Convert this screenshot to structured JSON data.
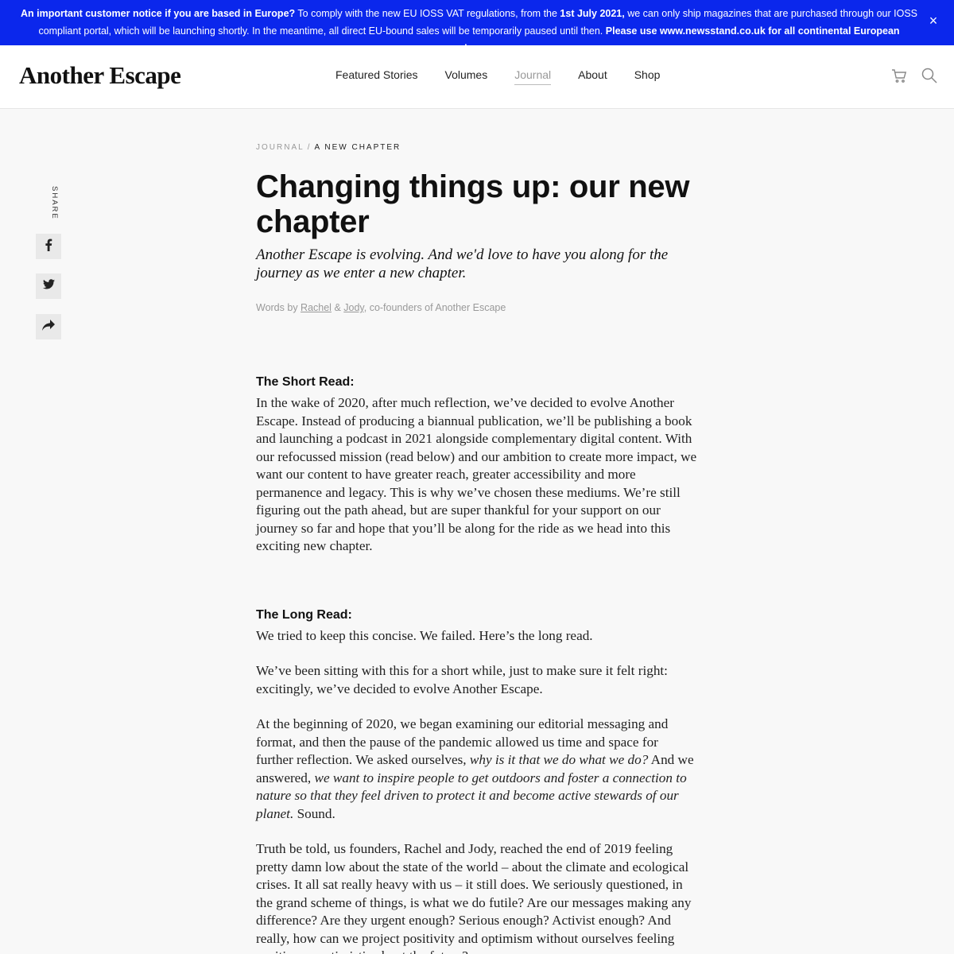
{
  "notice": {
    "lead": "An important customer notice if you are based in Europe?",
    "text1": " To comply with the new EU IOSS VAT regulations, from the ",
    "date": "1st July 2021,",
    "text2": " we can only ship magazines that are purchased through our IOSS compliant portal, which will be launching shortly. In the meantime, all direct EU-bound sales will be temporarily paused until then. ",
    "cta": "Please use www.newsstand.co.uk for all continental European purchases.",
    "close": "×"
  },
  "header": {
    "logo": "Another Escape",
    "nav": [
      "Featured Stories",
      "Volumes",
      "Journal",
      "About",
      "Shop"
    ],
    "active_nav": "Journal"
  },
  "share": {
    "label": "SHARE"
  },
  "article": {
    "breadcrumb": {
      "parent": "JOURNAL",
      "sep": "/",
      "current": "A NEW CHAPTER"
    },
    "title": "Changing things up: our new chapter",
    "subtitle": "Another Escape is evolving. And we'd love to have you along for the journey as we enter a new chapter.",
    "byline": {
      "prefix": "Words by ",
      "author1": "Rachel",
      "amp": " & ",
      "author2": "Jody",
      "suffix": ", co-founders of Another Escape"
    },
    "short_heading": "The Short Read:",
    "short_body": "In the wake of 2020, after much reflection, we’ve decided to evolve Another Escape. Instead of producing a biannual publication, we’ll be publishing a book and launching a podcast in 2021 alongside complementary digital content. With our refocussed mission (read below) and our ambition to create more impact, we want our content to have greater reach, greater accessibility and more permanence and legacy. This is why we’ve chosen these mediums. We’re still figuring out the path ahead, but are super thankful for your support on our journey so far and hope that you’ll be along for the ride as we head into this exciting new chapter.",
    "long_heading": "The Long Read:",
    "long_p1": "We tried to keep this concise. We failed. Here’s the long read.",
    "long_p2": "We’ve been sitting with this for a short while, just to make sure it felt right: excitingly, we’ve decided to evolve Another Escape.",
    "long_p3a": "At the beginning of 2020, we began examining our editorial messaging and format, and then the pause of the pandemic allowed us time and space for further reflection. We asked ourselves, ",
    "long_p3b": "why is it that we do what we do?",
    "long_p3c": " And we answered, ",
    "long_p3d": "we want to inspire people to get outdoors and foster a connection to nature so that they feel driven to protect it and become active stewards of our planet.",
    "long_p3e": " Sound.",
    "long_p4": "Truth be told, us founders, Rachel and Jody, reached the end of 2019 feeling pretty damn low about the state of the world – about the climate and ecological crises. It all sat really heavy with us – it still does. We seriously questioned, in the grand scheme of things, is what we do futile? Are our messages making any difference? Are they urgent enough? Serious enough? Activist enough? And really, how can we project positivity and optimism without ourselves feeling positive or optimistic about the future?"
  }
}
